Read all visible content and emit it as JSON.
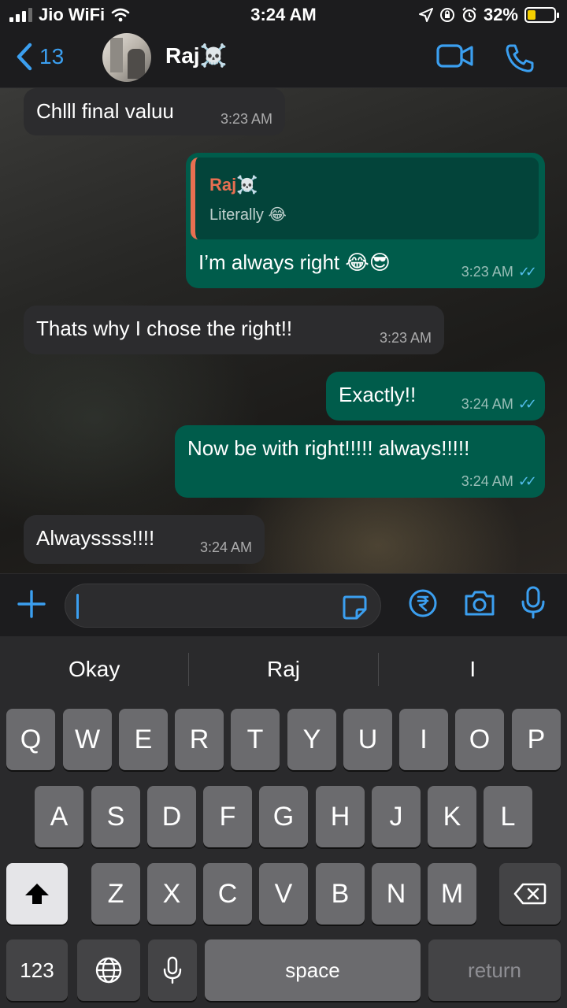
{
  "status_bar": {
    "carrier": "Jio WiFi",
    "time": "3:24 AM",
    "battery_percent": "32%",
    "battery_level": 0.32,
    "icons": [
      "signal-icon",
      "wifi-icon",
      "location-icon",
      "lock-rotation-icon",
      "alarm-icon",
      "battery-charging-icon"
    ]
  },
  "header": {
    "back_count": "13",
    "contact_name": "Raj☠️",
    "icons": [
      "back-chevron-icon",
      "video-call-icon",
      "voice-call-icon"
    ]
  },
  "messages": [
    {
      "direction": "incoming",
      "text": "Chlll final valuu",
      "time": "3:23 AM"
    },
    {
      "direction": "outgoing",
      "quote_author": "Raj☠️",
      "quote_text": "Literally 😂",
      "text": "I’m always right 😂😎",
      "time": "3:23 AM",
      "read": true
    },
    {
      "direction": "incoming",
      "text": "Thats why I chose the right!!",
      "time": "3:23 AM"
    },
    {
      "direction": "outgoing",
      "text": "Exactly!!",
      "time": "3:24 AM",
      "read": true
    },
    {
      "direction": "outgoing",
      "text": "Now be with right!!!!! always!!!!!",
      "time": "3:24 AM",
      "read": true
    },
    {
      "direction": "incoming",
      "text": "Alwayssss!!!!",
      "time": "3:24 AM"
    }
  ],
  "input_bar": {
    "value": "",
    "icons": [
      "plus-icon",
      "sticker-icon",
      "rupee-payment-icon",
      "camera-icon",
      "microphone-icon"
    ]
  },
  "keyboard": {
    "suggestions": [
      "Okay",
      "Raj",
      "I"
    ],
    "row1": [
      "Q",
      "W",
      "E",
      "R",
      "T",
      "Y",
      "U",
      "I",
      "O",
      "P"
    ],
    "row2": [
      "A",
      "S",
      "D",
      "F",
      "G",
      "H",
      "J",
      "K",
      "L"
    ],
    "row3": [
      "Z",
      "X",
      "C",
      "V",
      "B",
      "N",
      "M"
    ],
    "numbers_label": "123",
    "space_label": "space",
    "return_label": "return"
  },
  "colors": {
    "accent": "#3b9ff0",
    "outgoing_bubble": "#005c4b",
    "incoming_bubble": "#2c2c2e",
    "read_ticks": "#53bdeb",
    "quote_author": "#e76f51"
  }
}
